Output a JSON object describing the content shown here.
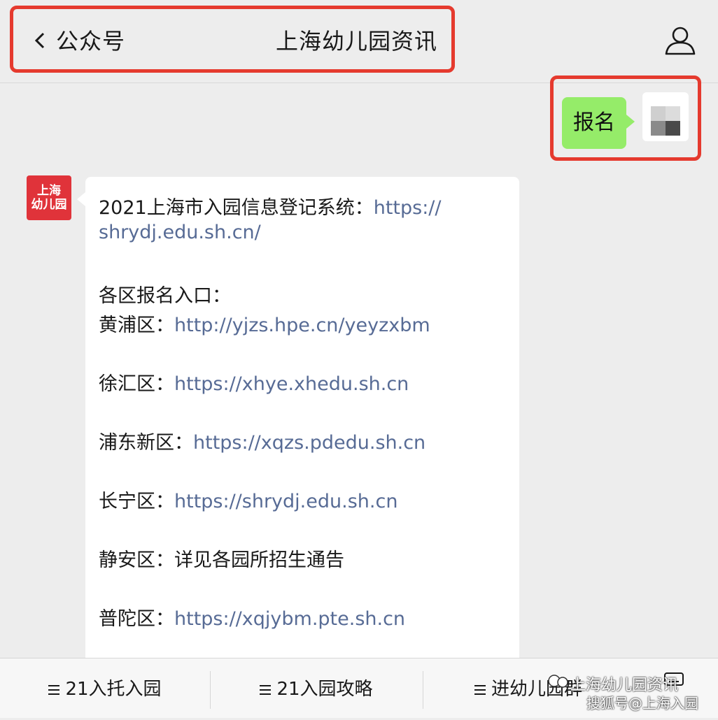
{
  "header": {
    "back_label": "公众号",
    "title": "上海幼儿园资讯",
    "profile_icon": "person-icon"
  },
  "outgoing_message": {
    "text": "报名"
  },
  "official_account_avatar": {
    "line1": "上海",
    "line2": "幼儿园"
  },
  "incoming_message": {
    "line1_text": "2021上海市入园信息登记系统：",
    "line1_link": "https://",
    "line2_link": "shrydj.edu.sh.cn/",
    "section_heading": "各区报名入口：",
    "districts": [
      {
        "name": "黄浦区：",
        "value": "http://yjzs.hpe.cn/yeyzxbm",
        "is_link": true
      },
      {
        "name": "徐汇区：",
        "value": "https://xhye.xhedu.sh.cn",
        "is_link": true
      },
      {
        "name": "浦东新区：",
        "value": "https://xqzs.pdedu.sh.cn",
        "is_link": true
      },
      {
        "name": "长宁区：",
        "value": "https://shrydj.edu.sh.cn",
        "is_link": true
      },
      {
        "name": "静安区：",
        "value": "详见各园所招生通告",
        "is_link": false
      },
      {
        "name": "普陀区：",
        "value": "https://xqjybm.pte.sh.cn",
        "is_link": true
      }
    ]
  },
  "bottom_menu": {
    "items": [
      {
        "label": "21入托入园"
      },
      {
        "label": "21入园攻略"
      },
      {
        "label": "进幼儿园群"
      }
    ],
    "keyboard_icon": "keyboard-icon"
  },
  "watermark": {
    "line1": "上海幼儿园资讯",
    "line2": "搜狐号@上海入园"
  },
  "colors": {
    "chat_background": "#ededed",
    "outgoing_bubble": "#95ec69",
    "link": "#576b95",
    "highlight_box": "#e53a2e",
    "avatar_red": "#e0333a"
  }
}
